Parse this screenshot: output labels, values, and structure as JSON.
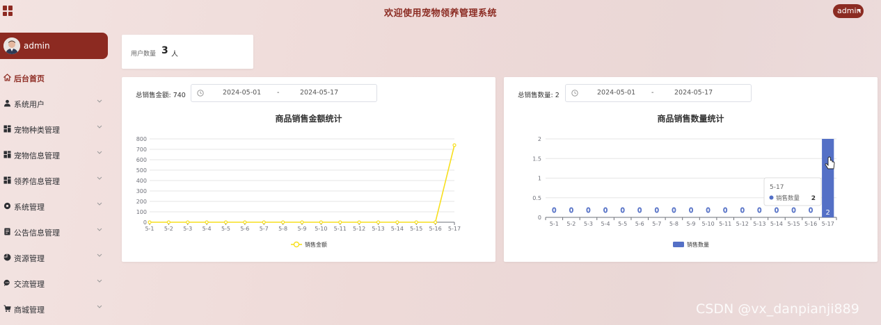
{
  "header": {
    "title": "欢迎使用宠物领养管理系统",
    "user_label": "admin"
  },
  "sidebar": {
    "user_name": "admin",
    "items": [
      {
        "label": "后台首页",
        "icon": "home-icon",
        "active": true,
        "has_arrow": false
      },
      {
        "label": "系统用户",
        "icon": "user-icon",
        "active": false,
        "has_arrow": true
      },
      {
        "label": "宠物种类管理",
        "icon": "grid-icon",
        "active": false,
        "has_arrow": true
      },
      {
        "label": "宠物信息管理",
        "icon": "grid-icon",
        "active": false,
        "has_arrow": true
      },
      {
        "label": "领养信息管理",
        "icon": "grid-icon",
        "active": false,
        "has_arrow": true
      },
      {
        "label": "系统管理",
        "icon": "gear-icon",
        "active": false,
        "has_arrow": true
      },
      {
        "label": "公告信息管理",
        "icon": "document-icon",
        "active": false,
        "has_arrow": true
      },
      {
        "label": "资源管理",
        "icon": "pie-chart-icon",
        "active": false,
        "has_arrow": true
      },
      {
        "label": "交流管理",
        "icon": "chat-icon",
        "active": false,
        "has_arrow": true
      },
      {
        "label": "商城管理",
        "icon": "cart-icon",
        "active": false,
        "has_arrow": true
      }
    ]
  },
  "stats": {
    "user_count_label": "用户数量",
    "user_count_value": "3",
    "user_count_unit": "人"
  },
  "sales_amount_panel": {
    "total_label": "总销售金额: 740",
    "date_start": "2024-05-01",
    "date_sep": "-",
    "date_end": "2024-05-17"
  },
  "sales_count_panel": {
    "total_label": "总销售数量: 2",
    "date_start": "2024-05-01",
    "date_sep": "-",
    "date_end": "2024-05-17",
    "tooltip": {
      "title": "5-17",
      "series": "销售数量",
      "value": "2"
    }
  },
  "chart_data": [
    {
      "type": "line",
      "title": "商品销售金额统计",
      "categories": [
        "5-1",
        "5-2",
        "5-3",
        "5-4",
        "5-5",
        "5-6",
        "5-7",
        "5-8",
        "5-9",
        "5-10",
        "5-11",
        "5-12",
        "5-13",
        "5-14",
        "5-15",
        "5-16",
        "5-17"
      ],
      "series": [
        {
          "name": "销售金额",
          "values": [
            0,
            0,
            0,
            0,
            0,
            0,
            0,
            0,
            0,
            0,
            0,
            0,
            0,
            0,
            0,
            0,
            740
          ],
          "color": "#f7df1e"
        }
      ],
      "ylim": [
        0,
        800
      ],
      "yticks": [
        0,
        100,
        200,
        300,
        400,
        500,
        600,
        700,
        800
      ],
      "grid": true,
      "legend": "bottom-center"
    },
    {
      "type": "bar",
      "title": "商品销售数量统计",
      "categories": [
        "5-1",
        "5-2",
        "5-3",
        "5-4",
        "5-5",
        "5-6",
        "5-7",
        "5-8",
        "5-9",
        "5-10",
        "5-11",
        "5-12",
        "5-13",
        "5-14",
        "5-15",
        "5-16",
        "5-17"
      ],
      "series": [
        {
          "name": "销售数量",
          "values": [
            0,
            0,
            0,
            0,
            0,
            0,
            0,
            0,
            0,
            0,
            0,
            0,
            0,
            0,
            0,
            0,
            2
          ],
          "color": "#5470c6"
        }
      ],
      "ylim": [
        0,
        2
      ],
      "yticks": [
        "0",
        "0.5",
        "1",
        "1.5",
        "2"
      ],
      "grid": true,
      "legend": "bottom-center",
      "data_labels": true
    }
  ],
  "watermark": "CSDN @vx_danpianji889"
}
